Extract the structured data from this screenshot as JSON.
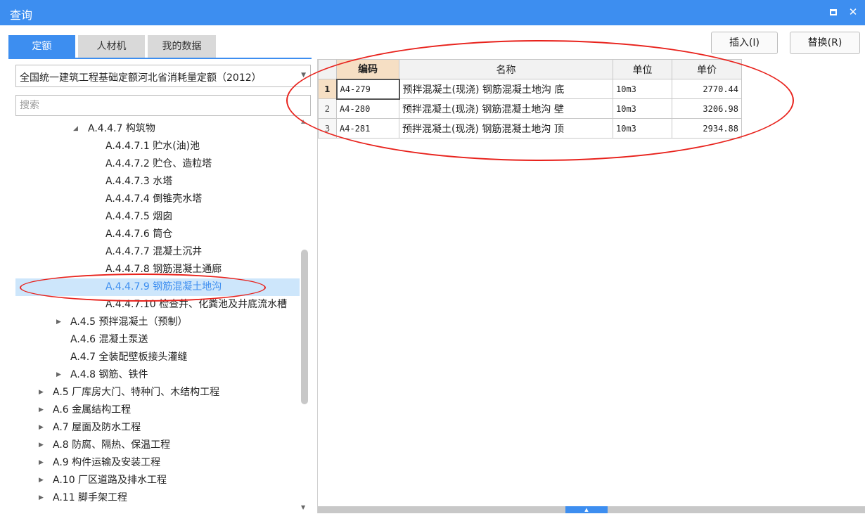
{
  "window": {
    "title": "查询",
    "maximize_icon": "maximize-icon",
    "close_icon": "close-icon",
    "close_glyph": "✕"
  },
  "tabs": [
    {
      "label": "定额",
      "active": true
    },
    {
      "label": "人材机",
      "active": false
    },
    {
      "label": "我的数据",
      "active": false
    }
  ],
  "actions": {
    "insert_label": "插入(I)",
    "replace_label": "替换(R)"
  },
  "library_select": {
    "value": "全国统一建筑工程基础定额河北省消耗量定额（2012）"
  },
  "search": {
    "placeholder": "搜索"
  },
  "tree": [
    {
      "label": "A.4.4.7 构筑物",
      "expanded": true
    },
    {
      "label": "A.4.4.7.1 贮水(油)池"
    },
    {
      "label": "A.4.4.7.2 贮仓、造粒塔"
    },
    {
      "label": "A.4.4.7.3 水塔"
    },
    {
      "label": "A.4.4.7.4 倒锥壳水塔"
    },
    {
      "label": "A.4.4.7.5 烟囱"
    },
    {
      "label": "A.4.4.7.6 筒仓"
    },
    {
      "label": "A.4.4.7.7 混凝土沉井"
    },
    {
      "label": "A.4.4.7.8 钢筋混凝土通廊"
    },
    {
      "label": "A.4.4.7.9 钢筋混凝土地沟",
      "selected": true
    },
    {
      "label": "A.4.4.7.10 检查井、化粪池及井底流水槽"
    },
    {
      "label": "A.4.5 预拌混凝土（预制）",
      "expanded": false
    },
    {
      "label": "A.4.6 混凝土泵送"
    },
    {
      "label": "A.4.7 全装配壁板接头灌缝"
    },
    {
      "label": "A.4.8 钢筋、铁件",
      "expanded": false
    },
    {
      "label": "A.5 厂库房大门、特种门、木结构工程",
      "expanded": false
    },
    {
      "label": "A.6 金属结构工程",
      "expanded": false
    },
    {
      "label": "A.7 屋面及防水工程",
      "expanded": false
    },
    {
      "label": "A.8 防腐、隔热、保温工程",
      "expanded": false
    },
    {
      "label": "A.9 构件运输及安装工程",
      "expanded": false
    },
    {
      "label": "A.10 厂区道路及排水工程",
      "expanded": false
    },
    {
      "label": "A.11 脚手架工程",
      "expanded": false
    }
  ],
  "grid": {
    "headers": {
      "code": "编码",
      "name": "名称",
      "unit": "单位",
      "price": "单价"
    },
    "rows": [
      {
        "num": "1",
        "code": "A4-279",
        "name": "预拌混凝土(现浇) 钢筋混凝土地沟 底",
        "unit": "10m3",
        "price": "2770.44"
      },
      {
        "num": "2",
        "code": "A4-280",
        "name": "预拌混凝土(现浇) 钢筋混凝土地沟 壁",
        "unit": "10m3",
        "price": "3206.98"
      },
      {
        "num": "3",
        "code": "A4-281",
        "name": "预拌混凝土(现浇) 钢筋混凝土地沟 顶",
        "unit": "10m3",
        "price": "2934.88"
      }
    ]
  },
  "colors": {
    "accent": "#3d8ef0",
    "selected_row": "#cde6fb",
    "annotation": "#e8221c",
    "header_highlight": "#f6dfc4"
  }
}
